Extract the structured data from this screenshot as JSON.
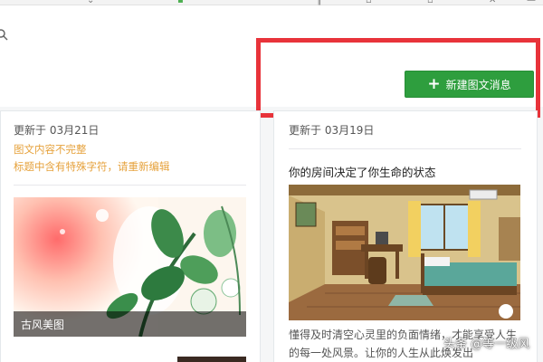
{
  "toolbar": {
    "icons": [
      "download-icon",
      "extension-icon",
      "menu-icon",
      "window-icon",
      "restore-icon",
      "close-icon"
    ]
  },
  "header": {
    "new_button_label": "新建图文消息",
    "new_button_icon": "plus-icon"
  },
  "cards": [
    {
      "updated": "更新于 03月21日",
      "warnings": [
        "图文内容不完整",
        "标题中含有特殊字符，请重新编辑"
      ],
      "cover_caption": "古风美图"
    },
    {
      "updated": "更新于 03月19日",
      "title": "你的房间决定了你生命的状态",
      "excerpt": "懂得及时清空心灵里的负面情绪，才能享受人生的每一处风景。让你的人生从此焕发出"
    }
  ],
  "watermark": "头条 @等一级风",
  "colors": {
    "accent_green": "#2e9e3e",
    "warning_orange": "#e6a23c",
    "annotation_red": "#e8333a"
  }
}
